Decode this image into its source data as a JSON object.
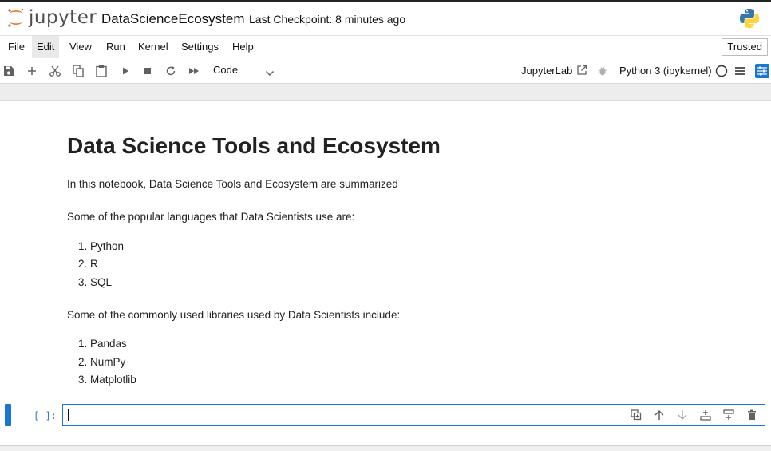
{
  "header": {
    "logo_text": "jupyter",
    "notebook_title": "DataScienceEcosystem",
    "checkpoint": "Last Checkpoint: 8 minutes ago"
  },
  "menu": {
    "items": [
      "File",
      "Edit",
      "View",
      "Run",
      "Kernel",
      "Settings",
      "Help"
    ],
    "trusted": "Trusted"
  },
  "toolbar": {
    "icons": [
      "save-icon",
      "add-cell-icon",
      "cut-icon",
      "copy-icon",
      "paste-icon",
      "run-icon",
      "stop-icon",
      "restart-icon",
      "fast-forward-icon"
    ],
    "cell_type": "Code",
    "jupyterlab_link": "JupyterLab",
    "kernel_name": "Python 3 (ipykernel)"
  },
  "notebook": {
    "heading": "Data Science Tools and Ecosystem",
    "intro": "In this notebook, Data Science Tools and Ecosystem are summarized",
    "languages_intro": "Some of the popular languages that Data Scientists use are:",
    "languages": [
      "1. Python",
      "2. R",
      "3. SQL"
    ],
    "libraries_intro": "Some of the commonly used libraries used by Data Scientists include:",
    "libraries": [
      "1. Pandas",
      "2. NumPy",
      "3. Matplotlib"
    ]
  },
  "cell": {
    "prompt": "[ ]:",
    "input_value": ""
  },
  "colors": {
    "accent": "#1976d2",
    "jupyter_orange": "#f37726",
    "prompt_blue": "#307fc1"
  }
}
